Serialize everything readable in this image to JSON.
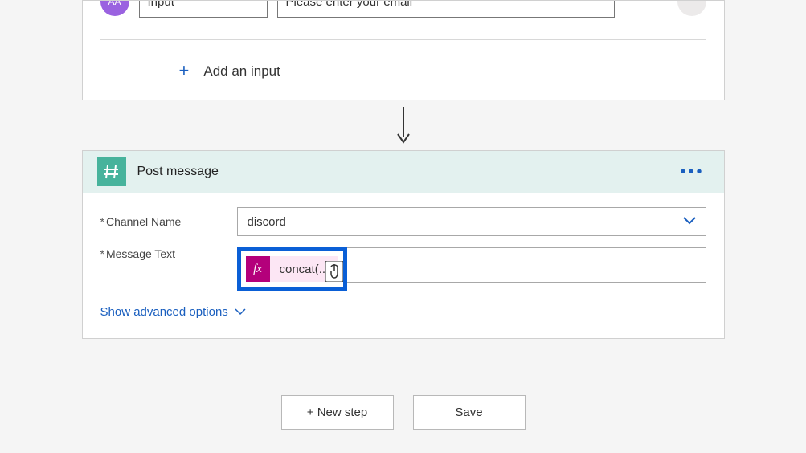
{
  "top_card": {
    "avatar_text": "AA",
    "input_name_placeholder": "Input",
    "input_desc_placeholder": "Please enter your email",
    "add_input_label": "Add an input"
  },
  "post_card": {
    "title": "Post message",
    "fields": {
      "channel_label": "Channel Name",
      "channel_value": "discord",
      "message_label": "Message Text",
      "token_text": "concat(..."
    },
    "advanced_label": "Show advanced options"
  },
  "buttons": {
    "new_step": "+ New step",
    "save": "Save"
  }
}
